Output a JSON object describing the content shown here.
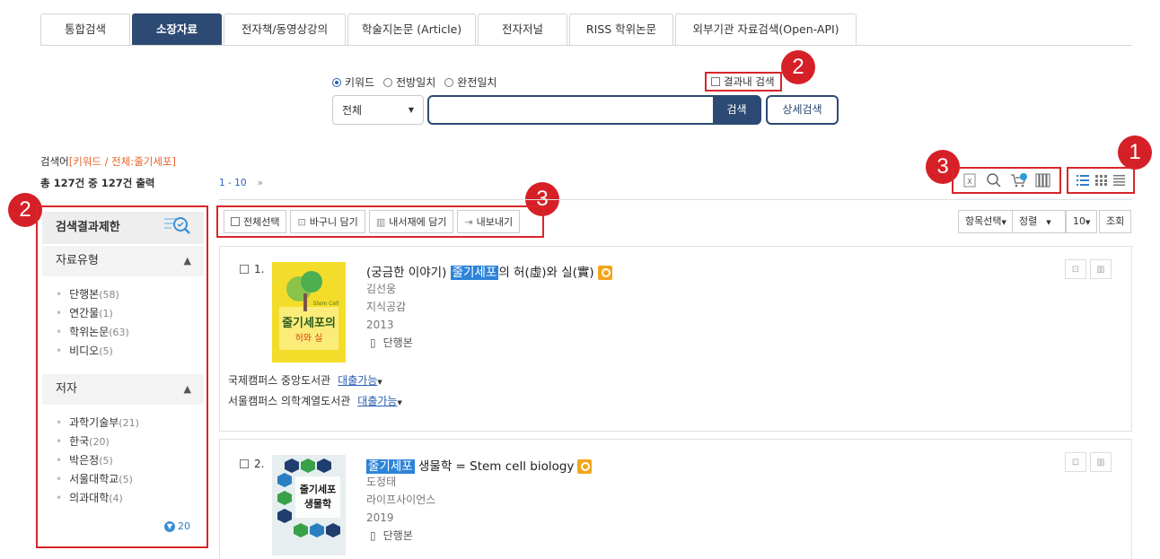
{
  "tabs": [
    {
      "label": "통합검색",
      "w": 100
    },
    {
      "label": "소장자료",
      "w": 100
    },
    {
      "label": "전자책/동영상강의",
      "w": 136
    },
    {
      "label": "학술지논문 (Article)",
      "w": 143
    },
    {
      "label": "전자저널",
      "w": 100
    },
    {
      "label": "RISS 학위논문",
      "w": 116
    },
    {
      "label": "외부기관 자료검색(Open-API)",
      "w": 202
    }
  ],
  "search": {
    "mode_keyword": "키워드",
    "mode_prefix": "전방일치",
    "mode_exact": "완전일치",
    "in_results": "결과내 검색",
    "scope": "전체",
    "search_btn": "검색",
    "advanced_btn": "상세검색"
  },
  "callouts": {
    "c1": "1",
    "c2a": "2",
    "c2b": "2",
    "c3a": "3",
    "c3b": "3"
  },
  "summary": {
    "query_prefix": "검색어",
    "query_value": "[키워드 / 전체:줄기세포]",
    "count_text": "총 127건 중 127건 출력",
    "page_range": "1 - 10",
    "next": "»"
  },
  "sidebar": {
    "title": "검색결과제한",
    "facet1": "자료유형",
    "facet1_items": [
      {
        "label": "단행본",
        "count": "(58)"
      },
      {
        "label": "연간물",
        "count": "(1)"
      },
      {
        "label": "학위논문",
        "count": "(63)"
      },
      {
        "label": "비디오",
        "count": "(5)"
      }
    ],
    "facet2": "저자",
    "facet2_items": [
      {
        "label": "과학기술부",
        "count": "(21)"
      },
      {
        "label": "한국",
        "count": "(20)"
      },
      {
        "label": "박은정",
        "count": "(5)"
      },
      {
        "label": "서울대학교",
        "count": "(5)"
      },
      {
        "label": "의과대학",
        "count": "(4)"
      }
    ],
    "more": "20"
  },
  "actions": {
    "select_all": "전체선택",
    "basket": "바구니 담기",
    "shelf": "내서재에 담기",
    "export": "내보내기"
  },
  "controls": {
    "fields": "항목선택",
    "sort": "정렬",
    "size": "10",
    "view": "조회"
  },
  "results": [
    {
      "no": "1.",
      "title_pre": "(궁금한 이야기) ",
      "title_mark": "줄기세포",
      "title_post": "의 허(虛)와 실(實)",
      "author": "김선웅",
      "publisher": "지식공감",
      "year": "2013",
      "type": "단행본",
      "holdings": [
        {
          "lib": "국제캠퍼스 중앙도서관",
          "status": "대출가능"
        },
        {
          "lib": "서울캠퍼스 의학계열도서관",
          "status": "대출가능"
        }
      ],
      "cover_text": "줄기세포의 허와 실",
      "cover_small": "Stem Cell"
    },
    {
      "no": "2.",
      "title_pre": "",
      "title_mark": "줄기세포",
      "title_post": " 생물학 = Stem cell biology",
      "author": "도정태",
      "publisher": "라이프사이언스",
      "year": "2019",
      "type": "단행본",
      "cover_text": "줄기세포 생물학"
    }
  ],
  "colors": {
    "brand": "#2c4a73",
    "highlight": "#2c84d9",
    "callout": "#d62027",
    "query": "#e8622c"
  }
}
